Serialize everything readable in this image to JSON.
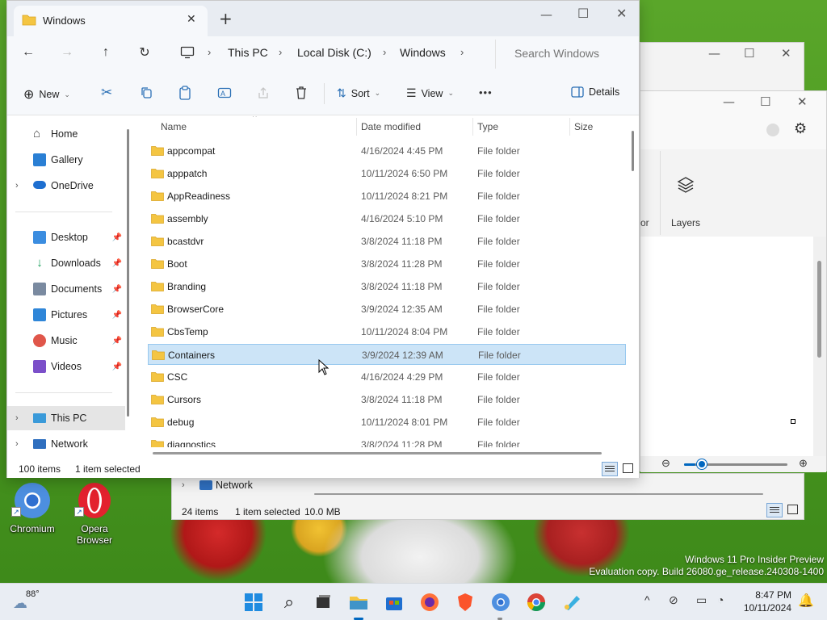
{
  "explorer": {
    "tab_title": "Windows",
    "breadcrumb": [
      "This PC",
      "Local Disk (C:)",
      "Windows"
    ],
    "search_placeholder": "Search Windows",
    "toolbar": {
      "new_label": "New",
      "sort_label": "Sort",
      "view_label": "View",
      "more_label": "•••",
      "details_label": "Details"
    },
    "nav": {
      "home": "Home",
      "gallery": "Gallery",
      "onedrive": "OneDrive",
      "desktop": "Desktop",
      "downloads": "Downloads",
      "documents": "Documents",
      "pictures": "Pictures",
      "music": "Music",
      "videos": "Videos",
      "this_pc": "This PC",
      "network": "Network"
    },
    "columns": {
      "name": "Name",
      "date": "Date modified",
      "type": "Type",
      "size": "Size"
    },
    "rows": [
      {
        "name": "appcompat",
        "date": "4/16/2024 4:45 PM",
        "type": "File folder"
      },
      {
        "name": "apppatch",
        "date": "10/11/2024 6:50 PM",
        "type": "File folder"
      },
      {
        "name": "AppReadiness",
        "date": "10/11/2024 8:21 PM",
        "type": "File folder"
      },
      {
        "name": "assembly",
        "date": "4/16/2024 5:10 PM",
        "type": "File folder"
      },
      {
        "name": "bcastdvr",
        "date": "3/8/2024 11:18 PM",
        "type": "File folder"
      },
      {
        "name": "Boot",
        "date": "3/8/2024 11:28 PM",
        "type": "File folder"
      },
      {
        "name": "Branding",
        "date": "3/8/2024 11:18 PM",
        "type": "File folder"
      },
      {
        "name": "BrowserCore",
        "date": "3/9/2024 12:35 AM",
        "type": "File folder"
      },
      {
        "name": "CbsTemp",
        "date": "10/11/2024 8:04 PM",
        "type": "File folder"
      },
      {
        "name": "Containers",
        "date": "3/9/2024 12:39 AM",
        "type": "File folder"
      },
      {
        "name": "CSC",
        "date": "4/16/2024 4:29 PM",
        "type": "File folder"
      },
      {
        "name": "Cursors",
        "date": "3/8/2024 11:18 PM",
        "type": "File folder"
      },
      {
        "name": "debug",
        "date": "10/11/2024 8:01 PM",
        "type": "File folder"
      },
      {
        "name": "diagnostics",
        "date": "3/8/2024 11:28 PM",
        "type": "File folder"
      }
    ],
    "selected_row": "Containers",
    "status": {
      "count": "100 items",
      "selected": "1 item selected"
    }
  },
  "back_window": {
    "layers_label": "Layers",
    "partial_label": "or",
    "nav_network": "Network",
    "status_count": "24 items",
    "status_selected": "1 item selected",
    "status_size": "10.0 MB"
  },
  "desktop_icons": [
    {
      "label": "Chromium"
    },
    {
      "label": "Opera\nBrowser"
    }
  ],
  "watermark": {
    "line1": "Windows 11 Pro Insider Preview",
    "line2": "Evaluation copy. Build 26080.ge_release.240308-1400"
  },
  "taskbar": {
    "weather_temp": "88°",
    "time": "8:47 PM",
    "date": "10/11/2024"
  },
  "colors": {
    "accent": "#0067c0",
    "selection": "#cce4f7",
    "folder": "#f4c542"
  }
}
